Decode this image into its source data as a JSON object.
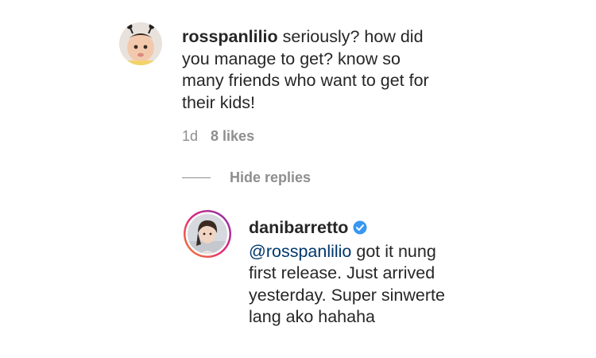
{
  "comment": {
    "username": "rosspanlilio",
    "text": "seriously? how did you manage to get? know so many friends who want to get for their kids!",
    "time": "1d",
    "likes": "8 likes"
  },
  "replies_toggle": {
    "label": "Hide replies"
  },
  "reply": {
    "username": "danibarretto",
    "mention": "@rosspanlilio",
    "text": "got it nung first release. Just arrived yesterday. Super sinwerte lang ako hahaha",
    "verified": true
  },
  "colors": {
    "text": "#262626",
    "muted": "#8e8e8e",
    "mention": "#00376b",
    "verified": "#3897f0"
  }
}
